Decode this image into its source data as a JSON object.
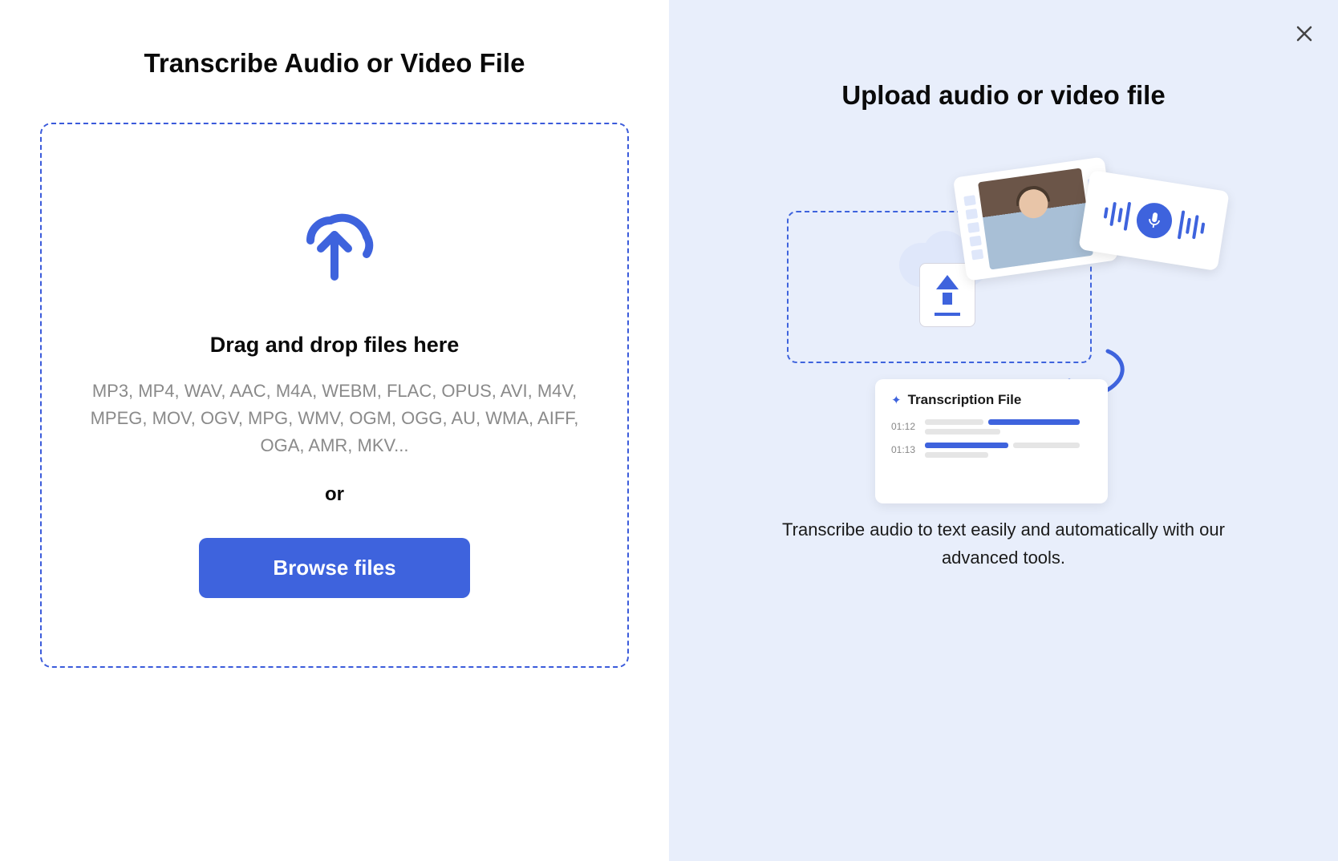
{
  "left": {
    "title": "Transcribe Audio or Video File",
    "drag_drop": "Drag and drop files here",
    "formats": "MP3, MP4, WAV, AAC, M4A, WEBM, FLAC, OPUS, AVI, M4V, MPEG, MOV, OGV, MPG, WMV, OGM, OGG, AU, WMA, AIFF, OGA, AMR, MKV...",
    "or": "or",
    "browse": "Browse files"
  },
  "right": {
    "title": "Upload audio or video file",
    "transcription_label": "Transcription File",
    "timestamps": [
      "01:12",
      "01:13"
    ],
    "description": "Transcribe audio to text easily and automatically with our advanced tools."
  }
}
